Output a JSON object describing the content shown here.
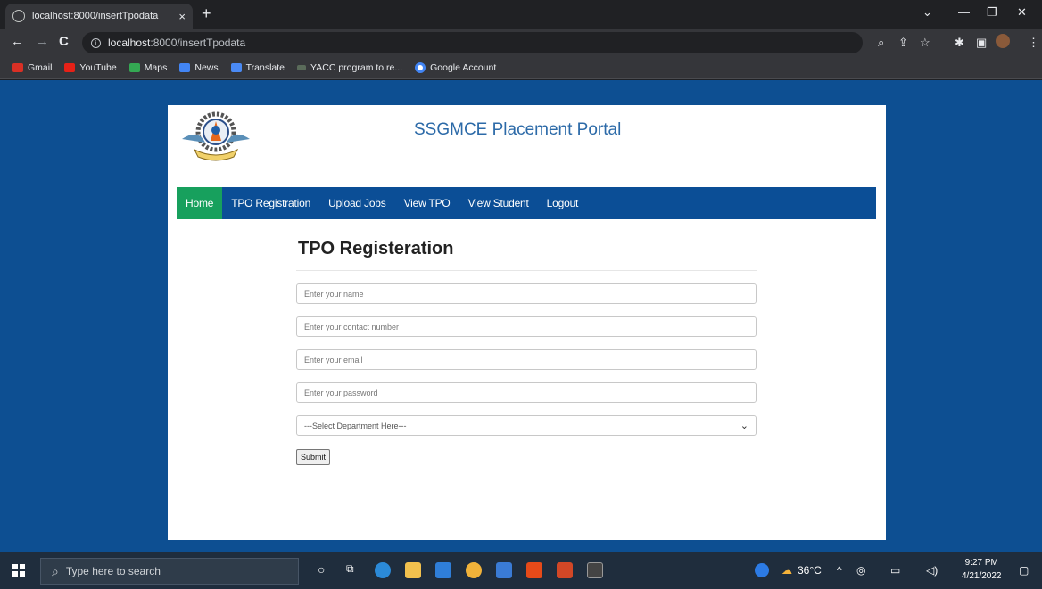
{
  "browser": {
    "tab_title": "localhost:8000/insertTpodata",
    "tab_close": "×",
    "new_tab": "+",
    "url_host": "localhost",
    "url_rest": ":8000/insertTpodata",
    "bookmarks": [
      "Gmail",
      "YouTube",
      "Maps",
      "News",
      "Translate",
      "YACC program to re...",
      "Google Account"
    ]
  },
  "site": {
    "title": "SSGMCE Placement Portal",
    "nav": [
      "Home",
      "TPO Registration",
      "Upload Jobs",
      "View TPO",
      "View Student",
      "Logout"
    ]
  },
  "form": {
    "heading": "TPO Registeration",
    "name_placeholder": "Enter your name",
    "contact_placeholder": "Enter your contact number",
    "email_placeholder": "Enter your email",
    "password_placeholder": "Enter your password",
    "department_selected": "---Select Department Here---",
    "submit_label": "Submit"
  },
  "taskbar": {
    "search_placeholder": "Type here to search",
    "temperature": "36°C",
    "time": "9:27 PM",
    "date": "4/21/2022"
  },
  "colors": {
    "page_background": "#0d4f92",
    "nav_background": "#0b4e96",
    "nav_active": "#17a05d",
    "title_color": "#2c6aa8"
  }
}
